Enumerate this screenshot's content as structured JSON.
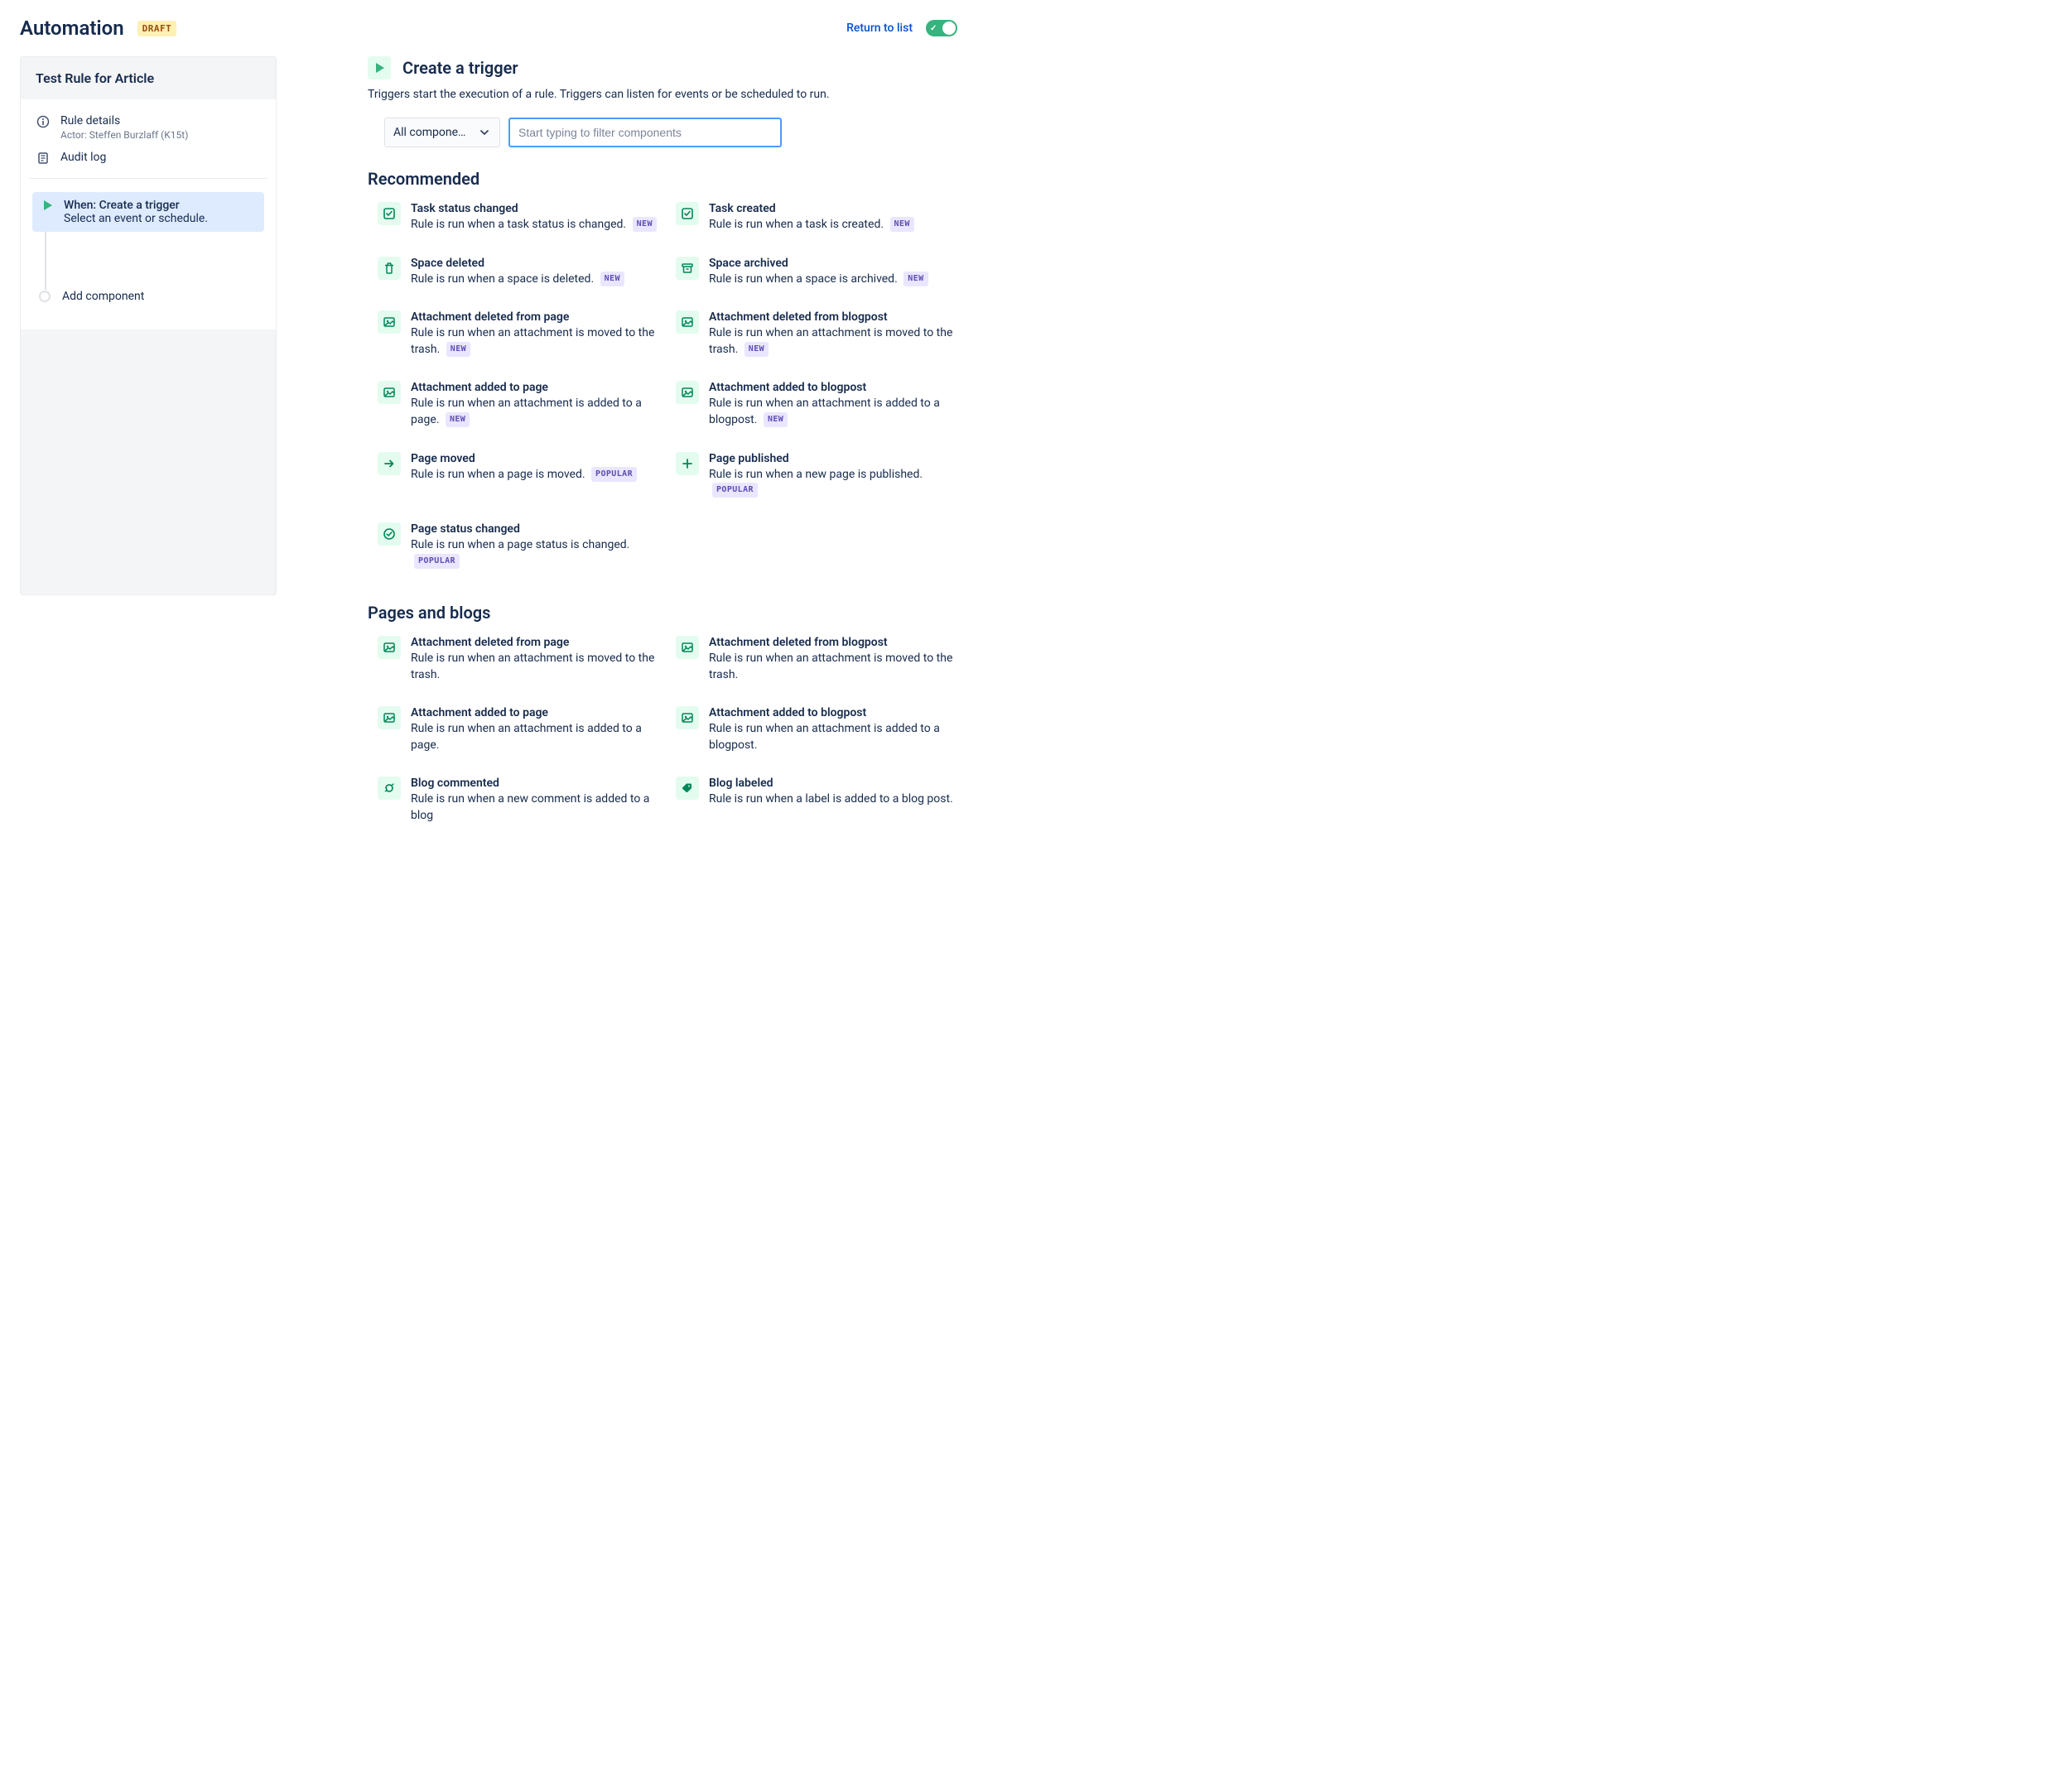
{
  "header": {
    "title": "Automation",
    "draft_label": "DRAFT",
    "return_label": "Return to list"
  },
  "sidebar": {
    "rule_name": "Test Rule for Article",
    "details_title": "Rule details",
    "details_actor": "Actor: Steffen Burzlaff (K15t)",
    "audit_log": "Audit log",
    "flow_when": "When: Create a trigger",
    "flow_when_sub": "Select an event or schedule.",
    "add_component": "Add component"
  },
  "main": {
    "title": "Create a trigger",
    "description": "Triggers start the execution of a rule. Triggers can listen for events or be scheduled to run.",
    "dropdown_label": "All compone…",
    "search_placeholder": "Start typing to filter components"
  },
  "pills": {
    "new": "NEW",
    "popular": "POPULAR"
  },
  "sections": {
    "recommended": {
      "title": "Recommended",
      "items": [
        {
          "icon": "checkbox",
          "title": "Task status changed",
          "desc": "Rule is run when a task status is changed.",
          "pill": "new"
        },
        {
          "icon": "checkbox",
          "title": "Task created",
          "desc": "Rule is run when a task is created.",
          "pill": "new"
        },
        {
          "icon": "trash",
          "title": "Space deleted",
          "desc": "Rule is run when a space is deleted.",
          "pill": "new"
        },
        {
          "icon": "archive",
          "title": "Space archived",
          "desc": "Rule is run when a space is archived.",
          "pill": "new"
        },
        {
          "icon": "image",
          "title": "Attachment deleted from page",
          "desc": "Rule is run when an attachment is moved to the trash.",
          "pill": "new"
        },
        {
          "icon": "image",
          "title": "Attachment deleted from blogpost",
          "desc": "Rule is run when an attachment is moved to the trash.",
          "pill": "new"
        },
        {
          "icon": "image",
          "title": "Attachment added to page",
          "desc": "Rule is run when an attachment is added to a page.",
          "pill": "new"
        },
        {
          "icon": "image",
          "title": "Attachment added to blogpost",
          "desc": "Rule is run when an attachment is added to a blogpost.",
          "pill": "new"
        },
        {
          "icon": "arrow",
          "title": "Page moved",
          "desc": "Rule is run when a page is moved.",
          "pill": "popular"
        },
        {
          "icon": "plus",
          "title": "Page published",
          "desc": "Rule is run when a new page is published.",
          "pill": "popular"
        },
        {
          "icon": "checkcircle",
          "title": "Page status changed",
          "desc": "Rule is run when a page status is changed.",
          "pill": "popular"
        }
      ]
    },
    "pages_and_blogs": {
      "title": "Pages and blogs",
      "items": [
        {
          "icon": "image",
          "title": "Attachment deleted from page",
          "desc": "Rule is run when an attachment is moved to the trash.",
          "pill": null
        },
        {
          "icon": "image",
          "title": "Attachment deleted from blogpost",
          "desc": "Rule is run when an attachment is moved to the trash.",
          "pill": null
        },
        {
          "icon": "image",
          "title": "Attachment added to page",
          "desc": "Rule is run when an attachment is added to a page.",
          "pill": null
        },
        {
          "icon": "image",
          "title": "Attachment added to blogpost",
          "desc": "Rule is run when an attachment is added to a blogpost.",
          "pill": null
        },
        {
          "icon": "refresh",
          "title": "Blog commented",
          "desc": "Rule is run when a new comment is added to a blog",
          "pill": null
        },
        {
          "icon": "tag",
          "title": "Blog labeled",
          "desc": "Rule is run when a label is added to a blog post.",
          "pill": null
        }
      ]
    }
  }
}
